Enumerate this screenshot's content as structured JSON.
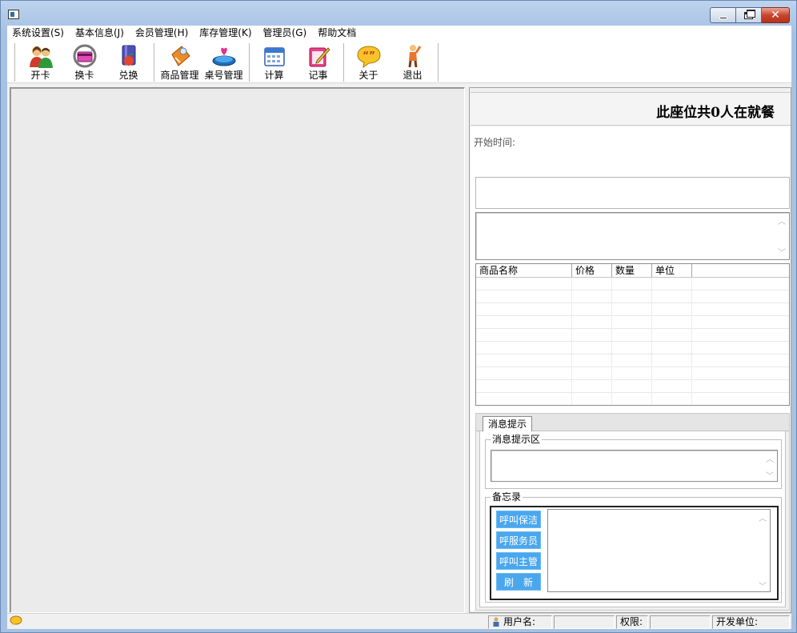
{
  "window": {
    "controls": {
      "minimize": "minimize-icon",
      "restore": "restore-icon",
      "close": "close-icon"
    }
  },
  "menu": {
    "items": [
      {
        "label": "系统设置(S)"
      },
      {
        "label": "基本信息(J)"
      },
      {
        "label": "会员管理(H)"
      },
      {
        "label": "库存管理(K)"
      },
      {
        "label": "管理员(G)"
      },
      {
        "label": "帮助文档"
      }
    ]
  },
  "toolbar": {
    "buttons": [
      {
        "label": "开卡",
        "icon": "users-icon"
      },
      {
        "label": "换卡",
        "icon": "card-swap-icon"
      },
      {
        "label": "兑换",
        "icon": "gift-book-icon"
      },
      {
        "label": "商品管理",
        "icon": "product-icon"
      },
      {
        "label": "桌号管理",
        "icon": "table-icon"
      },
      {
        "label": "计算",
        "icon": "calendar-icon"
      },
      {
        "label": "记事",
        "icon": "notepad-icon"
      },
      {
        "label": "关于",
        "icon": "speech-bubble-icon"
      },
      {
        "label": "退出",
        "icon": "exit-person-icon"
      }
    ]
  },
  "seat": {
    "title": "此座位共0人在就餐",
    "start_time_label": "开始时间:"
  },
  "goods_table": {
    "columns": [
      "商品名称",
      "价格",
      "数量",
      "单位",
      ""
    ],
    "rows": []
  },
  "messages": {
    "tab_label": "消息提示",
    "msg_group_label": "消息提示区",
    "memo_group_label": "备忘录",
    "call_buttons": [
      "呼叫保洁",
      "呼服务员",
      "呼叫主管",
      "刷　新"
    ]
  },
  "statusbar": {
    "user_label": "用户名:",
    "user_value": "",
    "perm_label": "权限:",
    "perm_value": "",
    "dev_label": "开发单位:"
  },
  "colors": {
    "call_button_bg": "#4aa7ee",
    "title_bar": "#a6c1e3",
    "close_button": "#c8442c"
  }
}
